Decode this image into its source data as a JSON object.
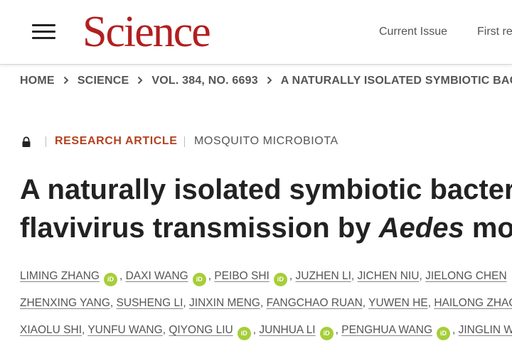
{
  "header": {
    "logo": "Science",
    "nav": [
      "Current Issue",
      "First release papers"
    ]
  },
  "breadcrumb": [
    "HOME",
    "SCIENCE",
    "VOL. 384, NO. 6693",
    "A NATURALLY ISOLATED SYMBIOTIC BACTERIUM"
  ],
  "article": {
    "type": "RESEARCH ARTICLE",
    "topic": "MOSQUITO MICROBIOTA",
    "title_line1": "A naturally isolated symbiotic bacterium",
    "title_line2_pre": "flavivirus transmission by ",
    "title_line2_italic": "Aedes",
    "title_line2_post": " mosquitoes",
    "orcid_label": "iD"
  },
  "authors": {
    "line1": [
      "LIMING ZHANG",
      "DAXI WANG",
      "PEIBO SHI",
      "JUZHEN LI",
      "JICHEN NIU",
      "JIELONG CHEN"
    ],
    "line2": [
      "ZHENXING YANG",
      "SUSHENG LI",
      "JINXIN MENG",
      "FANGCHAO RUAN",
      "YUWEN HE",
      "HAILONG ZHAO"
    ],
    "line3": [
      "XIAOLU SHI",
      "YUNFU WANG",
      "QIYONG LIU",
      "JUNHUA LI",
      "PENGHUA WANG",
      "JINGLIN WANG"
    ]
  },
  "colors": {
    "logo": "#b21f1f",
    "article_type": "#b4411f",
    "orcid": "#a6ce39"
  }
}
